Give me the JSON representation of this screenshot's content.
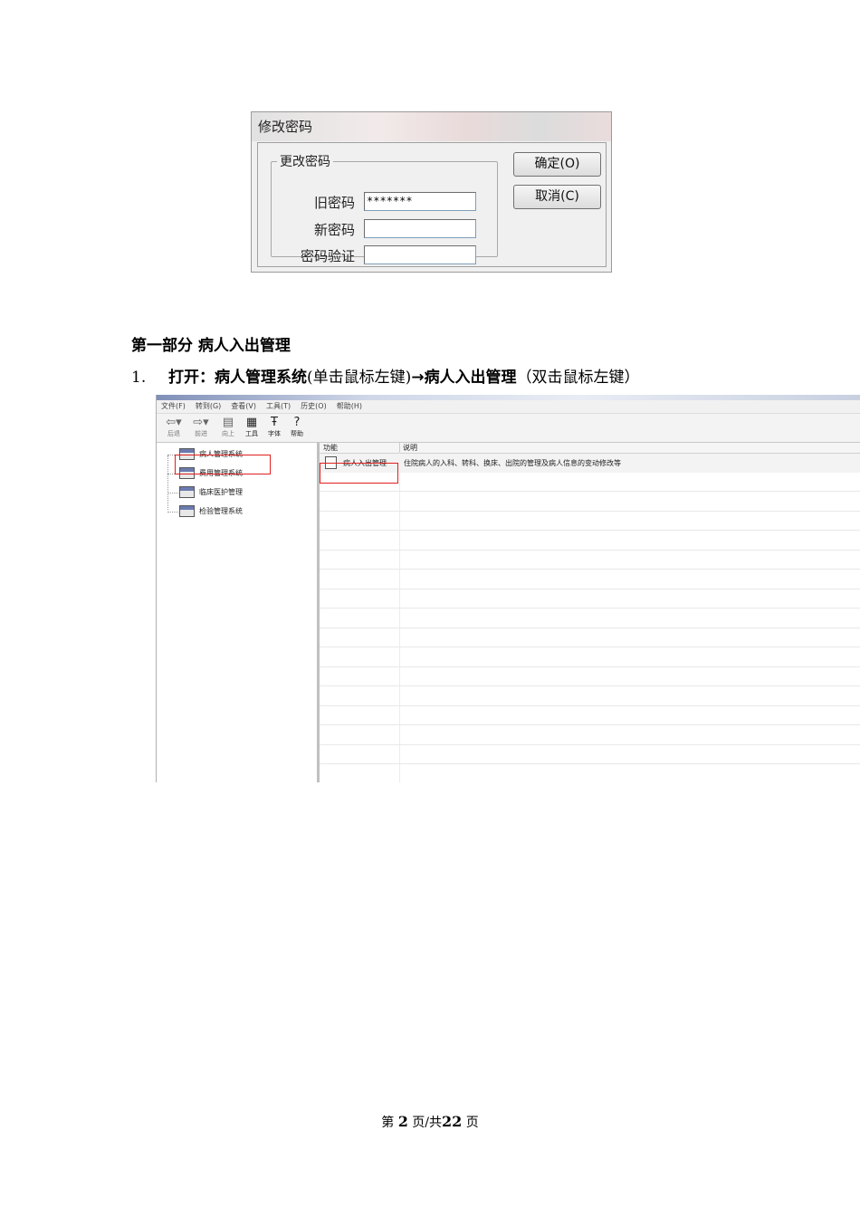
{
  "dialog": {
    "title": "修改密码",
    "group_label": "更改密码",
    "old_label": "旧密码",
    "old_value": "*******",
    "new_label": "新密码",
    "new_value": "",
    "verify_label": "密码验证",
    "verify_value": "",
    "ok_label": "确定(O)",
    "cancel_label": "取消(C)"
  },
  "section": {
    "heading": "第一部分 病人入出管理",
    "step_number": "1.",
    "step_bold_1": "打开：病人管理系统",
    "step_normal_1": "(单击鼠标左键)",
    "step_arrow": "→",
    "step_bold_2": "病人入出管理",
    "step_normal_2": "（双击鼠标左键）"
  },
  "explorer": {
    "menu": [
      "文件(F)",
      "转到(G)",
      "查看(V)",
      "工具(T)",
      "历史(O)",
      "帮助(H)"
    ],
    "toolbar": {
      "back": "后退",
      "forward": "前进",
      "up": "向上",
      "tools": "工具",
      "font": "字体",
      "help": "帮助"
    },
    "tree": [
      "病人管理系统",
      "费用管理系统",
      "临床医护管理",
      "检验管理系统"
    ],
    "list_header": {
      "col1": "功能",
      "col2": "说明"
    },
    "rows": [
      {
        "name": "病人入出管理",
        "desc": "住院病人的入科、转科、换床、出院的管理及病人信息的变动修改等"
      }
    ]
  },
  "footer": {
    "prefix": "第",
    "page": "2",
    "middle": "页/共",
    "total": "22",
    "suffix": "页"
  },
  "colors": {
    "highlight_box": "#e02020"
  }
}
